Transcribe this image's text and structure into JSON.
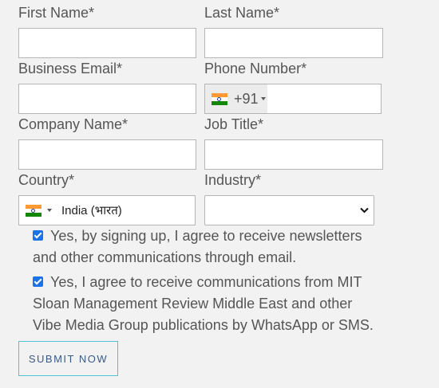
{
  "form": {
    "first_name_label": "First Name*",
    "last_name_label": "Last Name*",
    "business_email_label": "Business Email*",
    "phone_number_label": "Phone Number*",
    "company_name_label": "Company Name*",
    "job_title_label": "Job Title*",
    "country_label": "Country*",
    "industry_label": "Industry*",
    "phone_code": "+91",
    "phone_flag": "india-flag-icon",
    "country_value": "India (भारत)",
    "country_flag": "india-flag-icon",
    "industry_value": "",
    "newsletter_consent": {
      "checked": true,
      "line1": "Yes, by signing up, I agree to receive newsletters",
      "line2": "and other communications through email."
    },
    "whatsapp_consent": {
      "checked": true,
      "line1": "Yes, I agree to receive communications from MIT",
      "line2": "Sloan Management Review Middle East and other",
      "line3": "Vibe Media Group publications by WhatsApp or SMS."
    },
    "submit_label": "SUBMIT NOW"
  },
  "colors": {
    "background": "#f2f2f2",
    "checkbox": "#1a73e8",
    "submit_border": "#4fc3d4",
    "submit_text": "#3a5a8a"
  }
}
